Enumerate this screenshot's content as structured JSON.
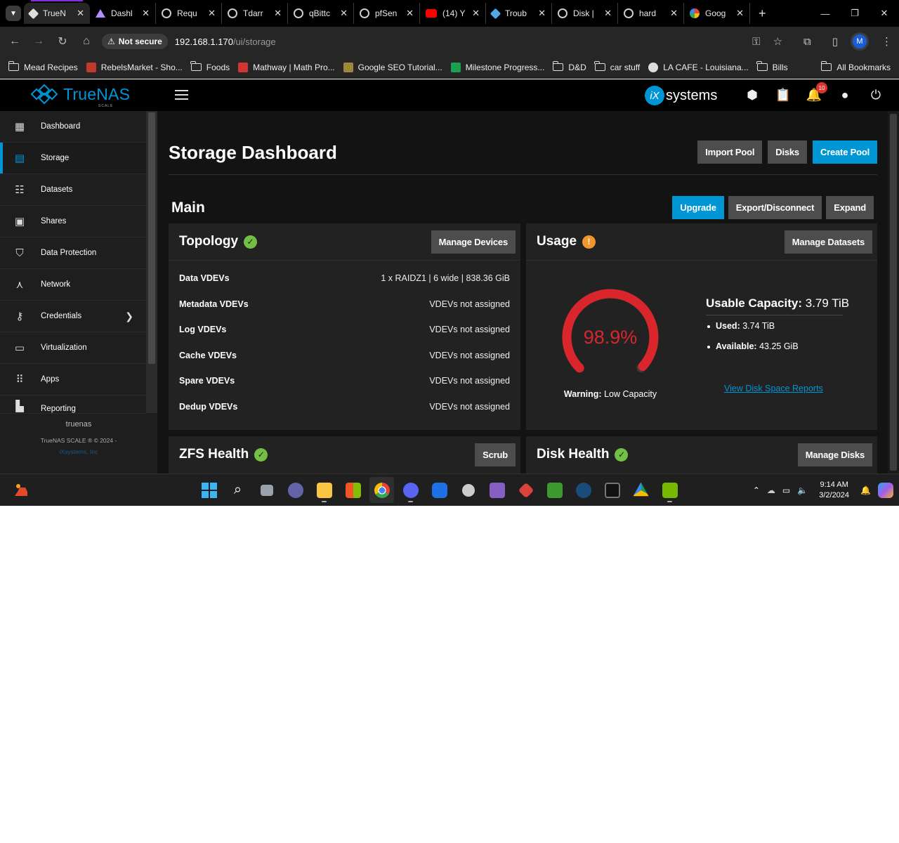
{
  "browser": {
    "tabs": [
      {
        "title": "TrueN",
        "icon": "truenas-icon",
        "active": true
      },
      {
        "title": "Dashl",
        "icon": "triangle-icon"
      },
      {
        "title": "Requ",
        "icon": "circle-icon"
      },
      {
        "title": "Tdarr",
        "icon": "circle-icon"
      },
      {
        "title": "qBittc",
        "icon": "circle-icon"
      },
      {
        "title": "pfSen",
        "icon": "circle-icon"
      },
      {
        "title": "(14) Y",
        "icon": "youtube-icon"
      },
      {
        "title": "Troub",
        "icon": "cube-icon"
      },
      {
        "title": "Disk |",
        "icon": "circle-icon"
      },
      {
        "title": "hard",
        "icon": "circle-icon"
      },
      {
        "title": "Goog",
        "icon": "google-icon"
      }
    ],
    "security_chip": "Not secure",
    "url_host": "192.168.1.170",
    "url_path": "/ui/storage",
    "profile_initial": "M",
    "bookmarks": [
      {
        "label": "Mead Recipes",
        "type": "folder"
      },
      {
        "label": "RebelsMarket - Sho...",
        "type": "site",
        "color": "#c0392b"
      },
      {
        "label": "Foods",
        "type": "folder"
      },
      {
        "label": "Mathway | Math Pro...",
        "type": "site",
        "color": "#d63333"
      },
      {
        "label": "Google SEO Tutorial...",
        "type": "site",
        "color": "#9a8a3a"
      },
      {
        "label": "Milestone Progress...",
        "type": "site",
        "color": "#1e9e50"
      },
      {
        "label": "D&D",
        "type": "folder"
      },
      {
        "label": "car stuff",
        "type": "folder"
      },
      {
        "label": "LA CAFE - Louisiana...",
        "type": "site",
        "color": "#dddddd"
      },
      {
        "label": "Bills",
        "type": "folder"
      }
    ],
    "all_bookmarks": "All Bookmarks"
  },
  "app": {
    "logo_text": "TrueNAS",
    "logo_sub": "SCALE",
    "vendor": "systems",
    "vendor_prefix": "iX",
    "notification_count": "10",
    "accent": "#0095d5"
  },
  "sidebar": {
    "items": [
      {
        "label": "Dashboard",
        "icon": "dashboard-icon"
      },
      {
        "label": "Storage",
        "icon": "storage-icon",
        "active": true
      },
      {
        "label": "Datasets",
        "icon": "datasets-icon"
      },
      {
        "label": "Shares",
        "icon": "shares-icon"
      },
      {
        "label": "Data Protection",
        "icon": "shield-icon"
      },
      {
        "label": "Network",
        "icon": "network-icon"
      },
      {
        "label": "Credentials",
        "icon": "key-icon"
      },
      {
        "label": "Virtualization",
        "icon": "laptop-icon"
      },
      {
        "label": "Apps",
        "icon": "apps-grid-icon"
      },
      {
        "label": "Reporting",
        "icon": "chart-icon"
      }
    ],
    "hostname": "truenas",
    "copyright": "TrueNAS SCALE ® © 2024 -",
    "company": "iXsystems, Inc"
  },
  "page": {
    "title": "Storage Dashboard",
    "buttons": {
      "import": "Import Pool",
      "disks": "Disks",
      "create": "Create Pool"
    }
  },
  "pool": {
    "name": "Main",
    "buttons": {
      "upgrade": "Upgrade",
      "export": "Export/Disconnect",
      "expand": "Expand"
    },
    "topology": {
      "title": "Topology",
      "button": "Manage Devices",
      "rows": [
        {
          "key": "Data VDEVs",
          "value": "1 x RAIDZ1 | 6 wide | 838.36 GiB"
        },
        {
          "key": "Metadata VDEVs",
          "value": "VDEVs not assigned"
        },
        {
          "key": "Log VDEVs",
          "value": "VDEVs not assigned"
        },
        {
          "key": "Cache VDEVs",
          "value": "VDEVs not assigned"
        },
        {
          "key": "Spare VDEVs",
          "value": "VDEVs not assigned"
        },
        {
          "key": "Dedup VDEVs",
          "value": "VDEVs not assigned"
        }
      ]
    },
    "usage": {
      "title": "Usage",
      "button": "Manage Datasets",
      "percent_label": "98.9%",
      "percent": 98.9,
      "gauge_color": "#d9262c",
      "warning_key": "Warning:",
      "warning_value": "Low Capacity",
      "capacity_label": "Usable Capacity:",
      "capacity_value": "3.79 TiB",
      "used_label": "Used:",
      "used_value": "3.74 TiB",
      "available_label": "Available:",
      "available_value": "43.25 GiB",
      "report_link": "View Disk Space Reports"
    },
    "zfs_health": {
      "title": "ZFS Health",
      "button": "Scrub"
    },
    "disk_health": {
      "title": "Disk Health",
      "button": "Manage Disks"
    }
  },
  "taskbar": {
    "time": "9:14 AM",
    "date": "3/2/2024"
  }
}
